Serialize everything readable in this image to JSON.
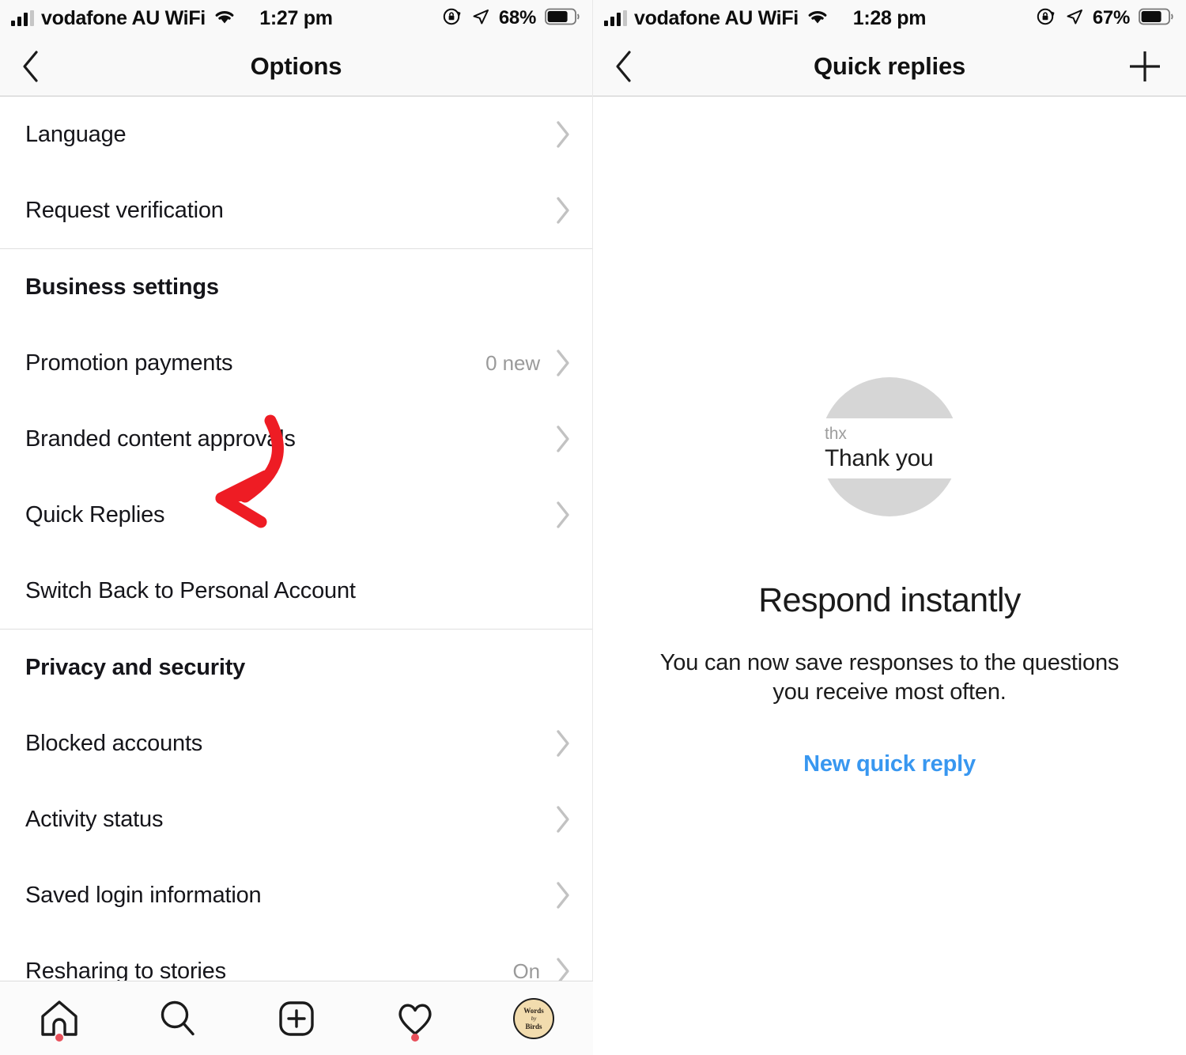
{
  "left": {
    "statusbar": {
      "carrier": "vodafone AU WiFi",
      "time": "1:27 pm",
      "battery_percent": "68%",
      "signal_icon": "cellular-bars-icon",
      "wifi_icon": "wifi-icon",
      "rotation_lock_icon": "rotation-lock-icon",
      "location_icon": "location-arrow-icon",
      "battery_icon": "battery-icon"
    },
    "navbar": {
      "title": "Options",
      "back_icon": "chevron-left-icon"
    },
    "items": [
      {
        "type": "row",
        "label": "Language",
        "value": "",
        "chevron": true
      },
      {
        "type": "row",
        "label": "Request verification",
        "value": "",
        "chevron": true
      },
      {
        "type": "divider"
      },
      {
        "type": "section",
        "label": "Business settings"
      },
      {
        "type": "row",
        "label": "Promotion payments",
        "value": "0 new",
        "chevron": true
      },
      {
        "type": "row",
        "label": "Branded content approvals",
        "value": "",
        "chevron": true
      },
      {
        "type": "row",
        "label": "Quick Replies",
        "value": "",
        "chevron": true
      },
      {
        "type": "row",
        "label": "Switch Back to Personal Account",
        "value": "",
        "chevron": false
      },
      {
        "type": "divider"
      },
      {
        "type": "section",
        "label": "Privacy and security"
      },
      {
        "type": "row",
        "label": "Blocked accounts",
        "value": "",
        "chevron": true
      },
      {
        "type": "row",
        "label": "Activity status",
        "value": "",
        "chevron": true
      },
      {
        "type": "row",
        "label": "Saved login information",
        "value": "",
        "chevron": true
      },
      {
        "type": "row",
        "label": "Resharing to stories",
        "value": "On",
        "chevron": true
      }
    ],
    "annotation": {
      "kind": "red-curved-arrow",
      "color": "#ee1c24",
      "points_to": "Quick Replies"
    },
    "tabbar": [
      {
        "name": "tab-home",
        "icon": "home-icon",
        "badge_dot": true
      },
      {
        "name": "tab-search",
        "icon": "search-icon",
        "badge_dot": false
      },
      {
        "name": "tab-create",
        "icon": "plus-square-icon",
        "badge_dot": false
      },
      {
        "name": "tab-activity",
        "icon": "heart-icon",
        "badge_dot": true
      },
      {
        "name": "tab-profile",
        "icon": "avatar-icon",
        "badge_dot": false
      }
    ],
    "avatar": {
      "line1": "Words",
      "line2": "by",
      "line3": "Birds"
    }
  },
  "right": {
    "statusbar": {
      "carrier": "vodafone AU WiFi",
      "time": "1:28 pm",
      "battery_percent": "67%",
      "signal_icon": "cellular-bars-icon",
      "wifi_icon": "wifi-icon",
      "rotation_lock_icon": "rotation-lock-icon",
      "location_icon": "location-arrow-icon",
      "battery_icon": "battery-icon"
    },
    "navbar": {
      "title": "Quick replies",
      "back_icon": "chevron-left-icon",
      "add_icon": "plus-icon"
    },
    "empty_state": {
      "illustration": {
        "keyword": "thx",
        "message": "Thank you",
        "circle_color": "#d6d6d6"
      },
      "title": "Respond instantly",
      "body": "You can now save responses to the questions you receive most often.",
      "link_label": "New quick reply",
      "link_color": "#3897f0"
    }
  }
}
